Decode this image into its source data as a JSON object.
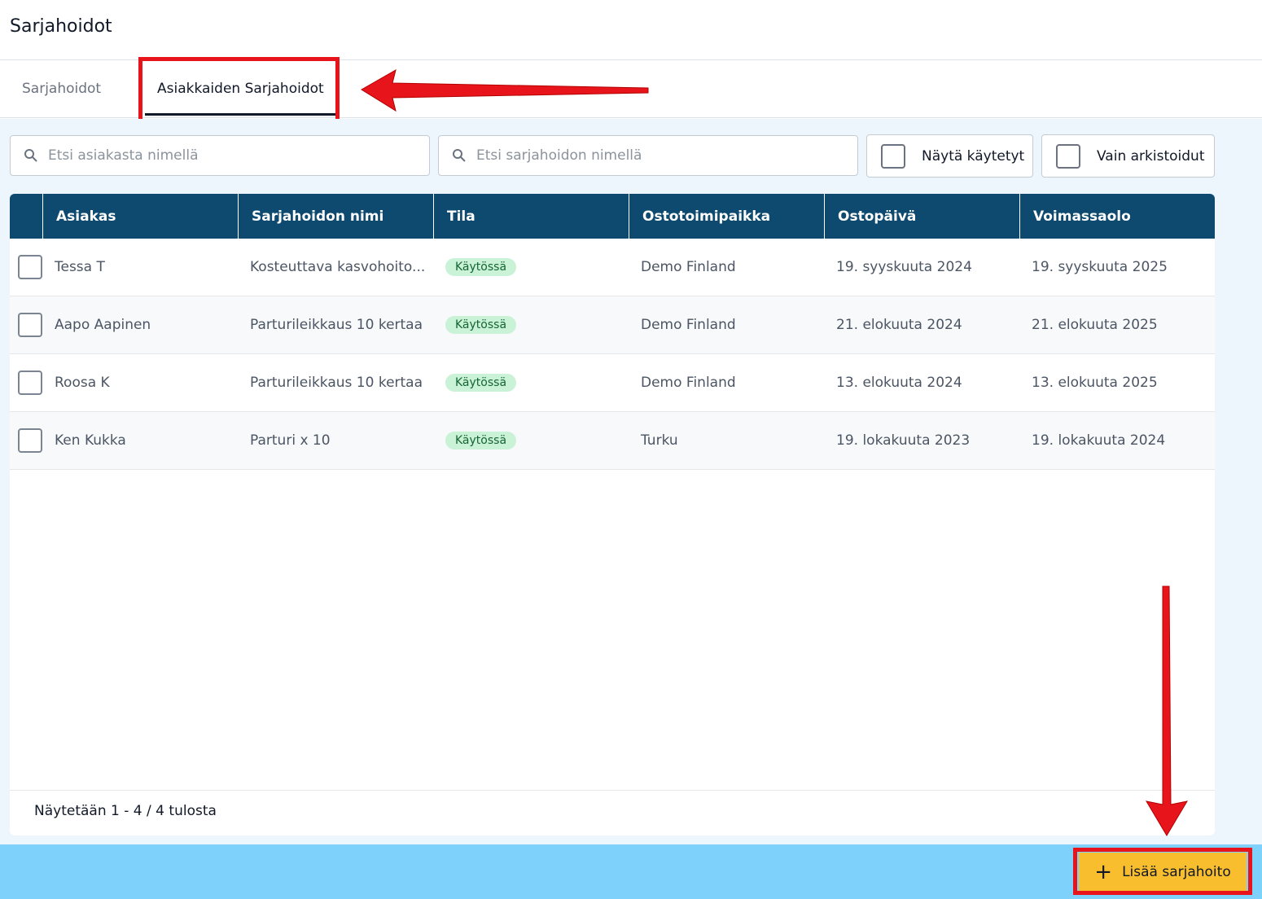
{
  "page": {
    "title": "Sarjahoidot"
  },
  "tabs": [
    {
      "label": "Sarjahoidot",
      "active": false
    },
    {
      "label": "Asiakkaiden Sarjahoidot",
      "active": true
    }
  ],
  "filters": {
    "customer_search": {
      "placeholder": "Etsi asiakasta nimellä",
      "value": ""
    },
    "series_search": {
      "placeholder": "Etsi sarjahoidon nimellä",
      "value": ""
    },
    "show_used": {
      "label": "Näytä käytetyt",
      "checked": false
    },
    "only_archived": {
      "label": "Vain arkistoidut",
      "checked": false
    }
  },
  "table": {
    "columns": [
      "Asiakas",
      "Sarjahoidon nimi",
      "Tila",
      "Ostotoimipaikka",
      "Ostopäivä",
      "Voimassaolo"
    ],
    "rows": [
      {
        "customer": "Tessa T",
        "series": "Kosteuttava kasvohoito...",
        "status": "Käytössä",
        "location": "Demo Finland",
        "purchase_date": "19. syyskuuta 2024",
        "valid_until": "19. syyskuuta 2025"
      },
      {
        "customer": "Aapo Aapinen",
        "series": "Parturileikkaus 10 kertaa",
        "status": "Käytössä",
        "location": "Demo Finland",
        "purchase_date": "21. elokuuta 2024",
        "valid_until": "21. elokuuta 2025"
      },
      {
        "customer": "Roosa K",
        "series": "Parturileikkaus 10 kertaa",
        "status": "Käytössä",
        "location": "Demo Finland",
        "purchase_date": "13. elokuuta 2024",
        "valid_until": "13. elokuuta 2025"
      },
      {
        "customer": "Ken Kukka",
        "series": "Parturi x 10",
        "status": "Käytössä",
        "location": "Turku",
        "purchase_date": "19. lokakuuta 2023",
        "valid_until": "19. lokakuuta 2024"
      }
    ]
  },
  "pagination": {
    "prefix": "Näytetään",
    "from": "1",
    "dash": "-",
    "to": "4",
    "slash": "/",
    "total": "4",
    "suffix": "tulosta"
  },
  "actions": {
    "add_label": "Lisää sarjahoito",
    "add_icon": "plus-icon"
  },
  "colors": {
    "header_bg": "#0e4a6f",
    "accent_yellow": "#f8be2e",
    "bottom_bar": "#7dd1fa",
    "annotation_red": "#e8141b",
    "badge_bg": "#c9f2d6"
  }
}
